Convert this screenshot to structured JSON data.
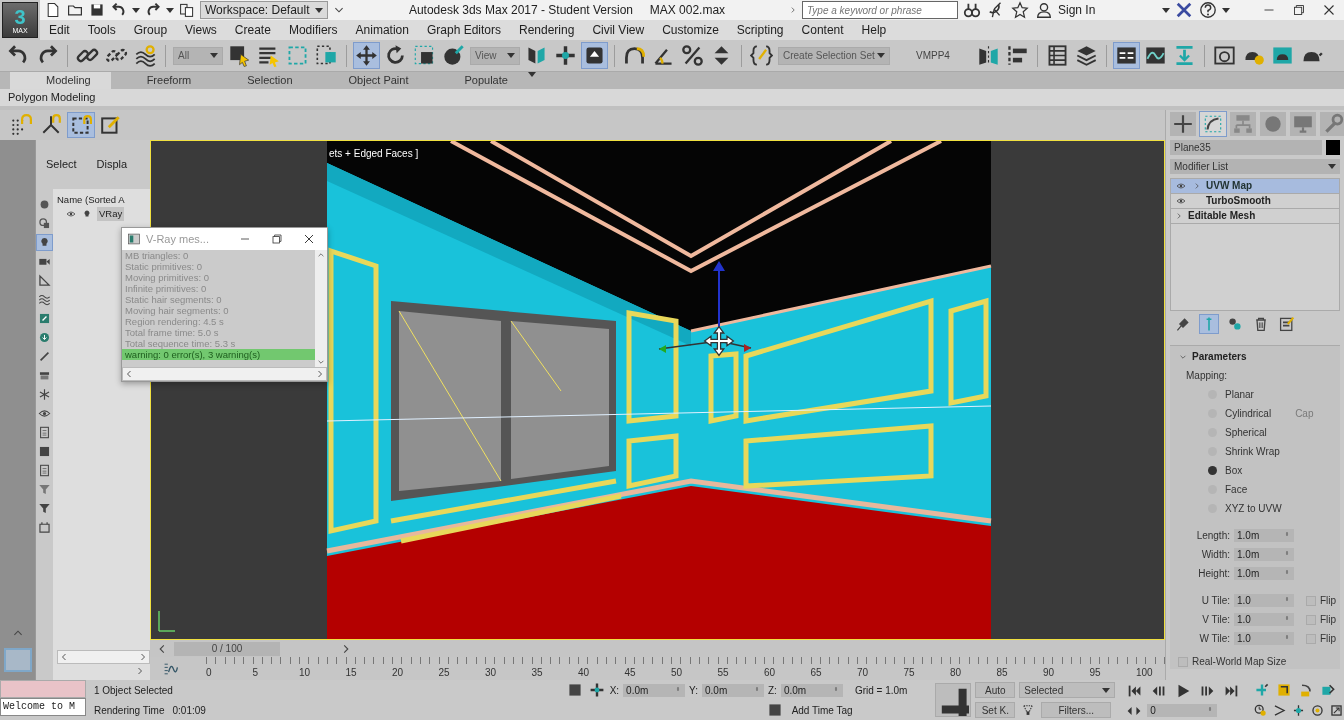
{
  "app_logo": {
    "number": "3",
    "label": "MAX"
  },
  "title_bar": {
    "workspace": "Workspace: Default",
    "title": "Autodesk 3ds Max 2017 - Student Version",
    "file": "MAX 002.max",
    "search_placeholder": "Type a keyword or phrase",
    "sign_in": "Sign In"
  },
  "menu": [
    "Edit",
    "Tools",
    "Group",
    "Views",
    "Create",
    "Modifiers",
    "Animation",
    "Graph Editors",
    "Rendering",
    "Civil View",
    "Customize",
    "Scripting",
    "Content",
    "Help"
  ],
  "toolbar": [
    {
      "kind": "icon",
      "active": false
    },
    {
      "kind": "icon",
      "active": false
    },
    {
      "kind": "separator"
    },
    {
      "kind": "icon",
      "active": false
    },
    {
      "kind": "icon",
      "active": false
    },
    {
      "kind": "icon",
      "active": false
    },
    {
      "kind": "separator"
    },
    {
      "kind": "dropdown",
      "value": "All"
    },
    {
      "kind": "icon",
      "active": false
    },
    {
      "kind": "icon",
      "active": false
    },
    {
      "kind": "icon",
      "active": false
    },
    {
      "kind": "icon",
      "active": false
    },
    {
      "kind": "separator"
    },
    {
      "kind": "icon",
      "active": true
    },
    {
      "kind": "icon",
      "active": false
    },
    {
      "kind": "icon",
      "active": false
    },
    {
      "kind": "icon",
      "active": false
    },
    {
      "kind": "dropdown",
      "value": "View"
    },
    {
      "kind": "icon",
      "active": false
    },
    {
      "kind": "icon",
      "active": false
    },
    {
      "kind": "icon",
      "active": true
    },
    {
      "kind": "separator"
    },
    {
      "kind": "icon",
      "active": false
    },
    {
      "kind": "icon",
      "active": false
    },
    {
      "kind": "icon",
      "active": false
    },
    {
      "kind": "icon",
      "active": false
    },
    {
      "kind": "separator"
    },
    {
      "kind": "icon",
      "active": false
    },
    {
      "kind": "dropdown",
      "value": "Create Selection Set"
    },
    {
      "kind": "label",
      "text": "VMPP4"
    },
    {
      "kind": "icon",
      "active": false
    },
    {
      "kind": "icon",
      "active": false
    },
    {
      "kind": "separator"
    },
    {
      "kind": "icon",
      "active": false
    },
    {
      "kind": "icon",
      "active": false
    },
    {
      "kind": "separator"
    },
    {
      "kind": "icon",
      "active": true
    },
    {
      "kind": "icon",
      "active": false
    },
    {
      "kind": "icon",
      "active": false
    },
    {
      "kind": "separator"
    },
    {
      "kind": "icon",
      "active": false
    },
    {
      "kind": "icon",
      "active": false
    },
    {
      "kind": "icon",
      "active": false
    },
    {
      "kind": "icon",
      "active": false
    }
  ],
  "ribbon": {
    "tabs": [
      {
        "label": "Modeling",
        "selected": true
      },
      {
        "label": "Freeform",
        "selected": false
      },
      {
        "label": "Selection",
        "selected": false
      },
      {
        "label": "Object Paint",
        "selected": false
      },
      {
        "label": "Populate",
        "selected": false
      }
    ],
    "panel": "Polygon Modeling"
  },
  "left_tools": [
    {
      "active": false
    },
    {
      "active": false
    },
    {
      "active": true
    },
    {
      "active": false
    }
  ],
  "scene_explorer": {
    "tabs": [
      "Select",
      "Displa"
    ],
    "column": "Name (Sorted A",
    "rows": [
      "VRay"
    ],
    "filters": [
      {
        "active": false
      },
      {
        "active": false
      },
      {
        "active": true
      },
      {
        "active": false
      },
      {
        "active": false
      },
      {
        "active": false
      },
      {
        "active": false
      },
      {
        "active": false
      },
      {
        "active": false
      },
      {
        "active": false
      },
      {
        "active": false
      },
      {
        "active": false
      },
      {
        "active": false
      },
      {
        "active": false
      },
      {
        "active": false
      },
      {
        "active": false
      },
      {
        "active": false
      },
      {
        "active": false
      }
    ]
  },
  "vray_window": {
    "title": "V-Ray mes...",
    "lines": [
      {
        "kind": "info",
        "text": "MB triangles: 0"
      },
      {
        "kind": "info",
        "text": "Static primitives: 0"
      },
      {
        "kind": "info",
        "text": "Moving primitives: 0"
      },
      {
        "kind": "info",
        "text": "Infinite primitives: 0"
      },
      {
        "kind": "info",
        "text": "Static hair segments: 0"
      },
      {
        "kind": "info",
        "text": "Moving hair segments: 0"
      },
      {
        "kind": "info",
        "text": "Region rendering: 4.5 s"
      },
      {
        "kind": "info",
        "text": "Total frame time: 5.0 s"
      },
      {
        "kind": "info",
        "text": "Total sequence time: 5.3 s"
      },
      {
        "kind": "warning",
        "text": "warning: 0 error(s), 3 warning(s)"
      }
    ]
  },
  "viewport": {
    "label": "ets + Edged Faces ]"
  },
  "command_panel": {
    "tabs": [
      {
        "selected": false
      },
      {
        "selected": true
      },
      {
        "selected": false
      },
      {
        "selected": false
      },
      {
        "selected": false
      },
      {
        "selected": false
      }
    ],
    "object_name": "Plane35",
    "modifier_list": "Modifier List",
    "stack": [
      {
        "name": "UVW Map",
        "selected": true,
        "enabled": true,
        "expandable": true
      },
      {
        "name": "TurboSmooth",
        "selected": false,
        "enabled": true,
        "expandable": false
      },
      {
        "name": "Editable Mesh",
        "selected": false,
        "enabled": false,
        "expandable": true
      }
    ],
    "stack_tools": [
      {
        "active": false
      },
      {
        "active": true
      },
      {
        "active": false
      },
      {
        "active": false
      },
      {
        "active": false
      }
    ],
    "rollout": {
      "title": "Parameters",
      "mapping_label": "Mapping:",
      "mapping": [
        {
          "label": "Planar",
          "selected": false
        },
        {
          "label": "Cylindrical",
          "selected": false,
          "option": "Cap"
        },
        {
          "label": "Spherical",
          "selected": false
        },
        {
          "label": "Shrink Wrap",
          "selected": false
        },
        {
          "label": "Box",
          "selected": true
        },
        {
          "label": "Face",
          "selected": false
        },
        {
          "label": "XYZ to UVW",
          "selected": false
        }
      ],
      "sizes": [
        {
          "label": "Length:",
          "value": "1.0m"
        },
        {
          "label": "Width:",
          "value": "1.0m"
        },
        {
          "label": "Height:",
          "value": "1.0m"
        }
      ],
      "tiles": [
        {
          "label": "U Tile:",
          "value": "1.0",
          "flip_label": "Flip",
          "flip": false
        },
        {
          "label": "V Tile:",
          "value": "1.0",
          "flip_label": "Flip",
          "flip": false
        },
        {
          "label": "W Tile:",
          "value": "1.0",
          "flip_label": "Flip",
          "flip": false
        }
      ],
      "real_world": {
        "label": "Real-World Map Size",
        "checked": false
      }
    }
  },
  "time_slider": {
    "frame": "0 / 100"
  },
  "track_bar": {
    "ticks": [
      "0",
      "5",
      "10",
      "15",
      "20",
      "25",
      "30",
      "35",
      "40",
      "45",
      "50",
      "55",
      "60",
      "65",
      "70",
      "75",
      "80",
      "85",
      "90",
      "95",
      "100"
    ]
  },
  "status_bar": {
    "listener_output": "Welcome to M",
    "selection": "1 Object Selected",
    "render_time_label": "Rendering Time",
    "render_time": "0:01:09",
    "coords": [
      {
        "axis": "X:",
        "value": "0.0m"
      },
      {
        "axis": "Y:",
        "value": "0.0m"
      },
      {
        "axis": "Z:",
        "value": "0.0m"
      }
    ],
    "grid": "Grid = 1.0m",
    "time_tag": "Add Time Tag",
    "auto_key": "Auto",
    "set_key": "Set K.",
    "key_filter": "Selected",
    "filters": "Filters...",
    "frame": "0"
  }
}
